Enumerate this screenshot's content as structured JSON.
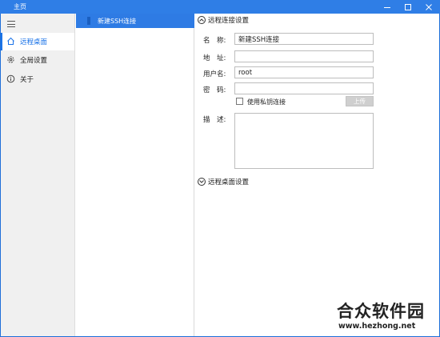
{
  "window": {
    "title": "主页"
  },
  "nav": {
    "items": [
      {
        "label": "远程桌面",
        "icon": "home-icon",
        "active": true
      },
      {
        "label": "全局设置",
        "icon": "gear-icon",
        "active": false
      },
      {
        "label": "关于",
        "icon": "info-icon",
        "active": false
      }
    ]
  },
  "connections": [
    {
      "label": "新建SSH连接",
      "selected": true
    }
  ],
  "detail": {
    "remote_connection_section": "远程连接设置",
    "name_label": "名　称:",
    "name_value": "新建SSH连接",
    "address_label": "地　址:",
    "address_value": "",
    "username_label": "用户名:",
    "username_value": "root",
    "password_label": "密　码:",
    "password_value": "",
    "private_key_label": "使用私钥连接",
    "upload_label": "上传",
    "description_label": "描　述:",
    "description_value": "",
    "remote_desktop_section": "远程桌面设置"
  },
  "watermark": {
    "logo_text": "合众软件园",
    "url": "www.hezhong.net"
  },
  "colors": {
    "accent": "#2f7ee6",
    "selected_item": "#2e7be4",
    "nav_background": "#f0f0f0"
  }
}
